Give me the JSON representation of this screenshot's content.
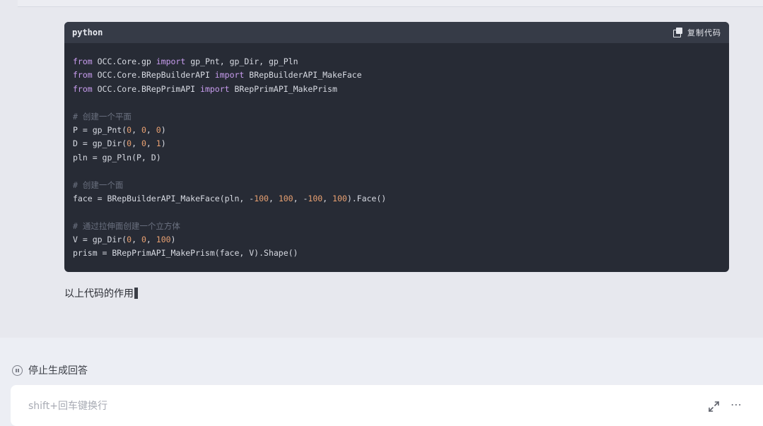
{
  "code_block": {
    "language": "python",
    "copy_label": "复制代码",
    "lines": [
      [
        {
          "t": "kw",
          "v": "from"
        },
        {
          "t": "p",
          "v": " OCC.Core.gp "
        },
        {
          "t": "kw",
          "v": "import"
        },
        {
          "t": "p",
          "v": " gp_Pnt, gp_Dir, gp_Pln"
        }
      ],
      [
        {
          "t": "kw",
          "v": "from"
        },
        {
          "t": "p",
          "v": " OCC.Core.BRepBuilderAPI "
        },
        {
          "t": "kw",
          "v": "import"
        },
        {
          "t": "p",
          "v": " BRepBuilderAPI_MakeFace"
        }
      ],
      [
        {
          "t": "kw",
          "v": "from"
        },
        {
          "t": "p",
          "v": " OCC.Core.BRepPrimAPI "
        },
        {
          "t": "kw",
          "v": "import"
        },
        {
          "t": "p",
          "v": " BRepPrimAPI_MakePrism"
        }
      ],
      [],
      [
        {
          "t": "cm",
          "v": "# 创建一个平面"
        }
      ],
      [
        {
          "t": "p",
          "v": "P = gp_Pnt("
        },
        {
          "t": "num",
          "v": "0"
        },
        {
          "t": "p",
          "v": ", "
        },
        {
          "t": "num",
          "v": "0"
        },
        {
          "t": "p",
          "v": ", "
        },
        {
          "t": "num",
          "v": "0"
        },
        {
          "t": "p",
          "v": ")"
        }
      ],
      [
        {
          "t": "p",
          "v": "D = gp_Dir("
        },
        {
          "t": "num",
          "v": "0"
        },
        {
          "t": "p",
          "v": ", "
        },
        {
          "t": "num",
          "v": "0"
        },
        {
          "t": "p",
          "v": ", "
        },
        {
          "t": "num",
          "v": "1"
        },
        {
          "t": "p",
          "v": ")"
        }
      ],
      [
        {
          "t": "p",
          "v": "pln = gp_Pln(P, D)"
        }
      ],
      [],
      [
        {
          "t": "cm",
          "v": "# 创建一个面"
        }
      ],
      [
        {
          "t": "p",
          "v": "face = BRepBuilderAPI_MakeFace(pln, -"
        },
        {
          "t": "num",
          "v": "100"
        },
        {
          "t": "p",
          "v": ", "
        },
        {
          "t": "num",
          "v": "100"
        },
        {
          "t": "p",
          "v": ", -"
        },
        {
          "t": "num",
          "v": "100"
        },
        {
          "t": "p",
          "v": ", "
        },
        {
          "t": "num",
          "v": "100"
        },
        {
          "t": "p",
          "v": ").Face()"
        }
      ],
      [],
      [
        {
          "t": "cm",
          "v": "# 通过拉伸面创建一个立方体"
        }
      ],
      [
        {
          "t": "p",
          "v": "V = gp_Dir("
        },
        {
          "t": "num",
          "v": "0"
        },
        {
          "t": "p",
          "v": ", "
        },
        {
          "t": "num",
          "v": "0"
        },
        {
          "t": "p",
          "v": ", "
        },
        {
          "t": "num",
          "v": "100"
        },
        {
          "t": "p",
          "v": ")"
        }
      ],
      [
        {
          "t": "p",
          "v": "prism = BRepPrimAPI_MakePrism(face, V).Shape()"
        }
      ]
    ]
  },
  "user_message": "以上代码的作用",
  "stop_button_label": "停止生成回答",
  "input": {
    "placeholder": "shift+回车键换行",
    "value": ""
  },
  "icons": {
    "copy": "copy-icon",
    "stop": "stop-icon",
    "expand": "expand-icon",
    "more": "more-icon"
  }
}
